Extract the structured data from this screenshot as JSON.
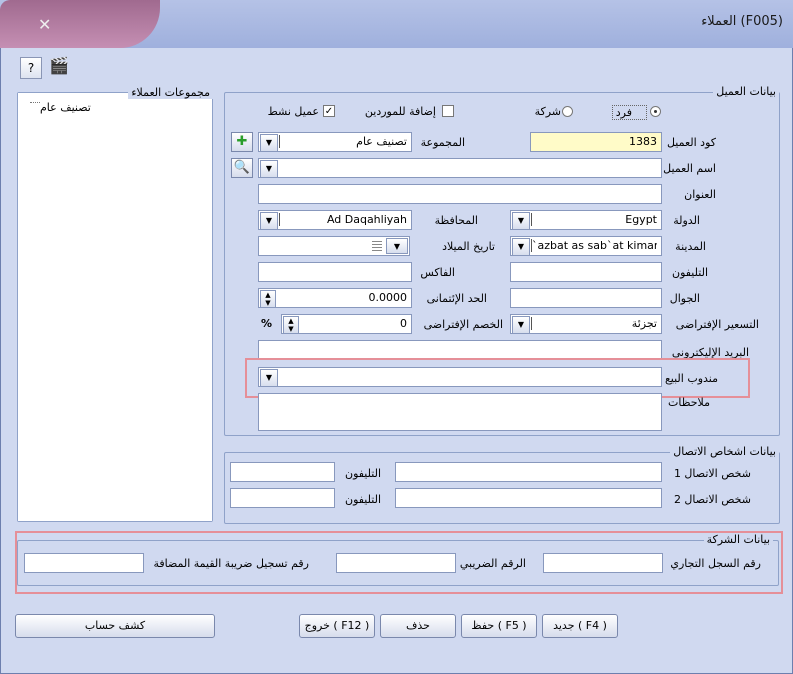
{
  "window": {
    "title": "العملاء  (F005)",
    "close_glyph": "✕"
  },
  "toolbar": {
    "help_glyph": "?",
    "clapper_glyph": "🎬"
  },
  "customer_groups": {
    "title": "مجموعات العملاء",
    "tree": [
      "تصنيف عام"
    ]
  },
  "customer_data": {
    "title": "بيانات العميل",
    "type_individual": "فرد",
    "type_company": "شركة",
    "add_to_suppliers": "إضافة للموردين",
    "active_customer": "عميل نشط",
    "code_label": "كود العميل",
    "code_value": "1383",
    "group_label": "المجموعة",
    "group_value": "تصنيف عام",
    "name_label": "اسم العميل",
    "name_value": "",
    "address_label": "العنوان",
    "country_label": "الدولة",
    "country_value": "Egypt",
    "governorate_label": "المحافظة",
    "governorate_value": "Ad Daqahliyah",
    "city_label": "المدينة",
    "city_value": "`azbat as sab`at kiman",
    "birthdate_label": "تاريخ الميلاد",
    "phone_label": "التليفون",
    "fax_label": "الفاكس",
    "mobile_label": "الجوال",
    "credit_limit_label": "الحد الإئتمانى",
    "credit_limit_value": "0.0000",
    "pricing_label": "التسعير الإفتراضى",
    "pricing_value": "تجزئة",
    "discount_label": "الخصم الإفتراضى",
    "discount_value": "0",
    "percent": "%",
    "email_label": "البريد الإليكترونى",
    "salesman_label": "مندوب البيع",
    "notes_label": "ملاحظات"
  },
  "contacts": {
    "title": "بيانات اشخاص الاتصال",
    "contact1_label": "شخص الاتصال 1",
    "contact2_label": "شخص الاتصال 2",
    "phone_label": "التليفون"
  },
  "company": {
    "title": "بيانات الشركة",
    "cr_label": "رقم السجل التجاري",
    "tax_label": "الرقم الضريبي",
    "vat_label": "رقم تسجيل ضريبة القيمة المضافة"
  },
  "buttons": {
    "statement": "كشف حساب",
    "exit": "خروج ( F12 )",
    "delete": "حذف",
    "save": "حفظ ( F5 )",
    "new": "جديد ( F4 )"
  },
  "colors": {
    "highlight": "#e58f98",
    "background": "#d0d9f0",
    "code_field": "#fffbc8"
  }
}
